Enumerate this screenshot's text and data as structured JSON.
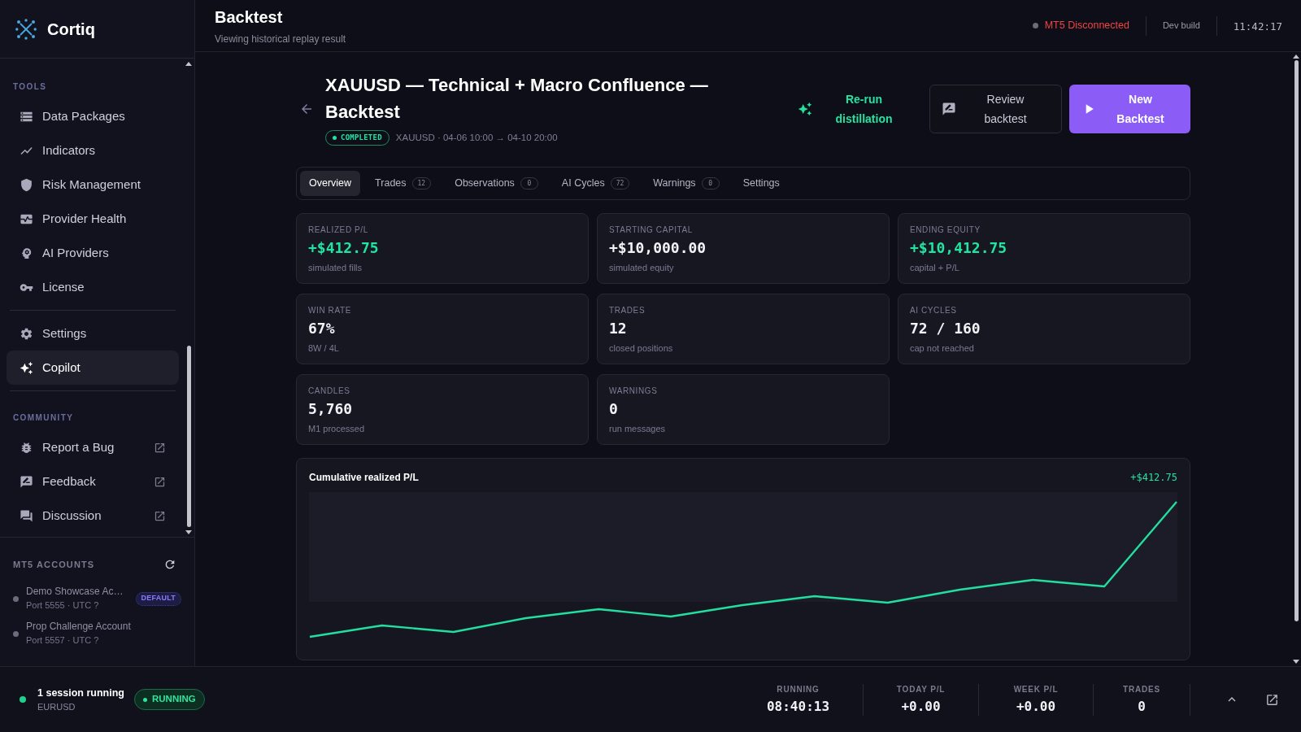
{
  "sidebar": {
    "brand": "Cortiq",
    "groups": [
      {
        "heading": "TOOLS",
        "items": [
          {
            "label": "Data Packages",
            "selected": false,
            "external": false
          },
          {
            "label": "Indicators",
            "selected": false,
            "external": false
          },
          {
            "label": "Risk Management",
            "selected": false,
            "external": false
          },
          {
            "label": "Provider Health",
            "selected": false,
            "external": false
          },
          {
            "label": "AI Providers",
            "selected": false,
            "external": false
          },
          {
            "label": "License",
            "selected": false,
            "external": false
          }
        ]
      },
      {
        "items": [
          {
            "label": "Settings",
            "selected": false,
            "external": false
          },
          {
            "label": "Copilot",
            "selected": true,
            "external": false
          }
        ]
      },
      {
        "heading": "COMMUNITY",
        "items": [
          {
            "label": "Report a Bug",
            "selected": false,
            "external": true
          },
          {
            "label": "Feedback",
            "selected": false,
            "external": true
          },
          {
            "label": "Discussion",
            "selected": false,
            "external": true
          }
        ]
      }
    ],
    "accounts": {
      "heading": "MT5 ACCOUNTS",
      "items": [
        {
          "name": "Demo Showcase Ac…",
          "detail": "Port 5555 · UTC ?",
          "badge": "DEFAULT"
        },
        {
          "name": "Prop Challenge Account",
          "detail": "Port 5557 · UTC ?"
        }
      ]
    }
  },
  "header": {
    "title": "Backtest",
    "subtitle": "Viewing historical replay result",
    "status": {
      "label": "MT5 Disconnected",
      "connected": false
    },
    "build": "Dev build",
    "clock": "11:42:17"
  },
  "backtest": {
    "title": "XAUUSD — Technical + Macro Confluence — Backtest",
    "status_badge": "COMPLETED",
    "meta": "XAUUSD · 04-06 10:00 → 04-10 20:00",
    "actions": [
      {
        "label": "Re-run distillation",
        "kind": "ghost"
      },
      {
        "label": "Review backtest",
        "kind": "outline"
      },
      {
        "label": "New Backtest",
        "kind": "primary"
      }
    ]
  },
  "tabs": [
    {
      "label": "Overview",
      "selected": true
    },
    {
      "label": "Trades",
      "count": "12",
      "selected": false
    },
    {
      "label": "Observations",
      "count": "0",
      "selected": false
    },
    {
      "label": "AI Cycles",
      "count": "72",
      "selected": false
    },
    {
      "label": "Warnings",
      "count": "0",
      "selected": false
    },
    {
      "label": "Settings",
      "selected": false
    }
  ],
  "stats": [
    {
      "label": "REALIZED P/L",
      "value": "+$412.75",
      "note": "simulated fills",
      "highlight": true
    },
    {
      "label": "STARTING CAPITAL",
      "value": "+$10,000.00",
      "note": "simulated equity",
      "highlight": false
    },
    {
      "label": "ENDING EQUITY",
      "value": "+$10,412.75",
      "note": "capital + P/L",
      "highlight": true
    },
    {
      "label": "WIN RATE",
      "value": "67%",
      "note": "8W / 4L",
      "highlight": false
    },
    {
      "label": "TRADES",
      "value": "12",
      "note": "closed positions",
      "highlight": false
    },
    {
      "label": "AI CYCLES",
      "value": "72 / 160",
      "note": "cap not reached",
      "highlight": false
    },
    {
      "label": "CANDLES",
      "value": "5,760",
      "note": "M1 processed",
      "highlight": false
    },
    {
      "label": "WARNINGS",
      "value": "0",
      "note": "run messages",
      "highlight": false
    }
  ],
  "chart": {
    "title": "Cumulative realized P/L",
    "total": "+$412.75"
  },
  "footer": {
    "session": {
      "title": "1 session running",
      "symbol": "EURUSD",
      "badge": "RUNNING",
      "running": true
    },
    "stats": [
      {
        "label": "RUNNING",
        "value": "08:40:13"
      },
      {
        "label": "TODAY P/L",
        "value": "+0.00"
      },
      {
        "label": "WEEK P/L",
        "value": "+0.00"
      },
      {
        "label": "TRADES",
        "value": "0"
      }
    ]
  }
}
